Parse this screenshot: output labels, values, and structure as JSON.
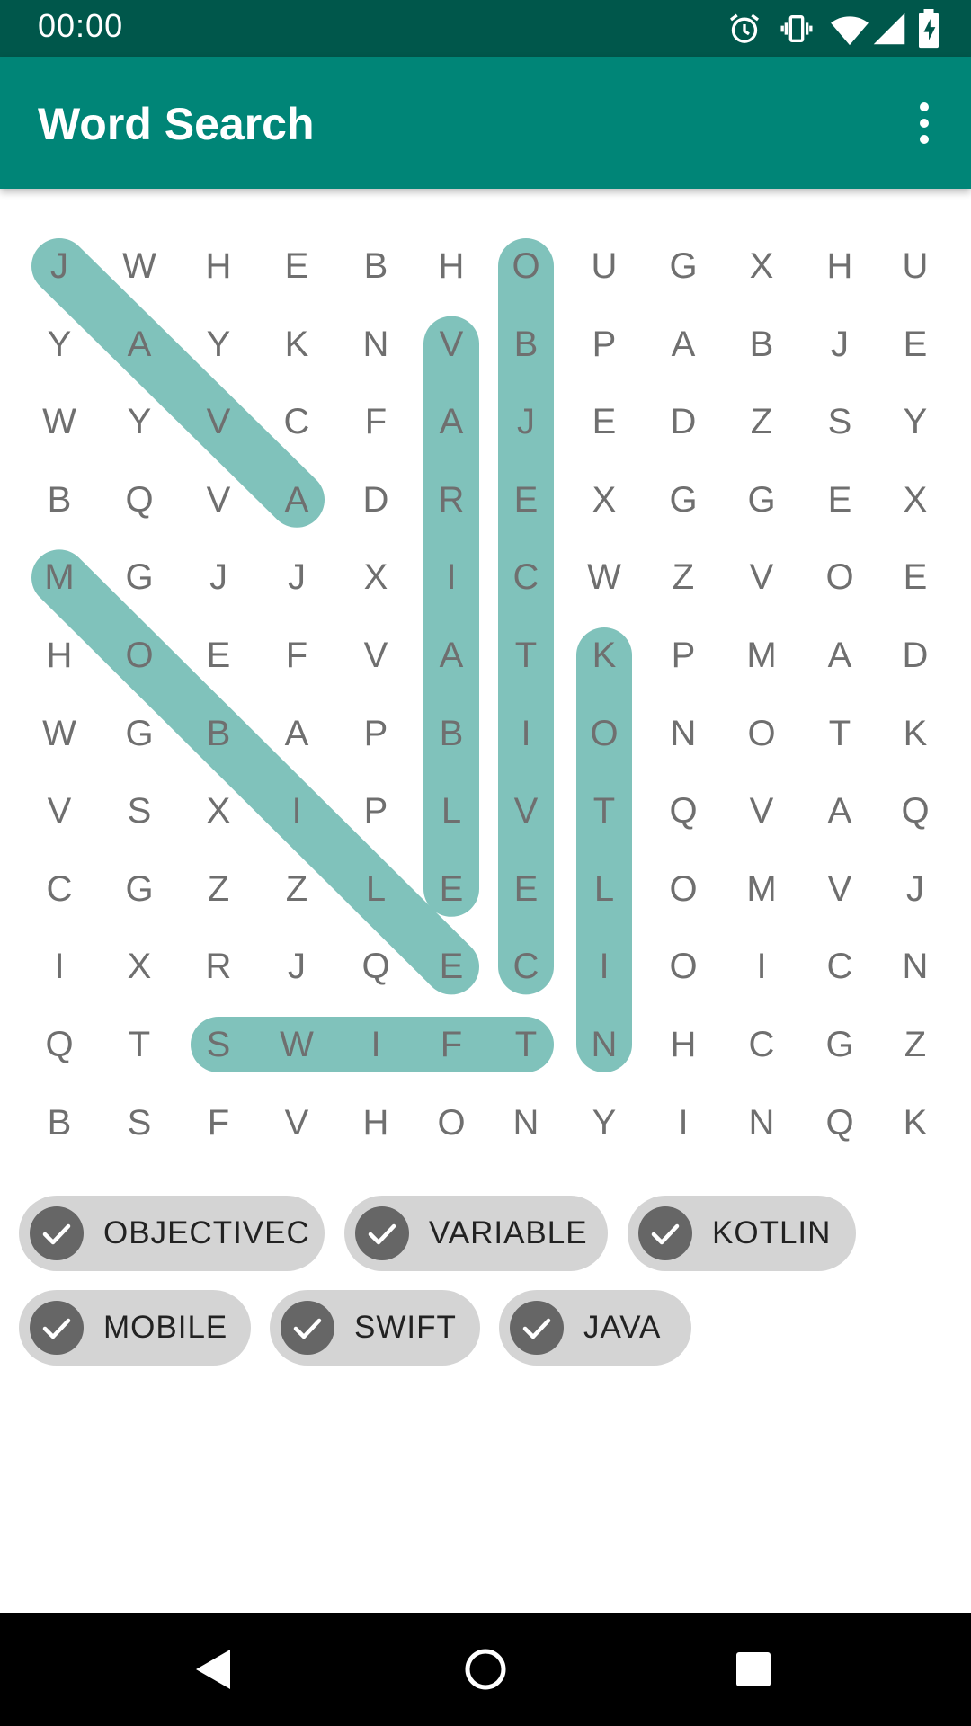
{
  "status_bar": {
    "time": "00:00",
    "icons": [
      "alarm-icon",
      "vibrate-icon",
      "wifi-icon",
      "signal-icon",
      "battery-charging-icon"
    ]
  },
  "app_bar": {
    "title": "Word Search",
    "menu_icon": "more-vert-icon"
  },
  "theme": {
    "primary": "#008577",
    "primary_dark": "#00574b",
    "highlight": "#80c2bb",
    "letter": "#6f6f6f",
    "chip_bg": "#d4d4d4",
    "chip_check": "#666666"
  },
  "grid": {
    "rows": [
      [
        "J",
        "W",
        "H",
        "E",
        "B",
        "H",
        "O",
        "U",
        "G",
        "X",
        "H",
        "U"
      ],
      [
        "Y",
        "A",
        "Y",
        "K",
        "N",
        "V",
        "B",
        "P",
        "A",
        "B",
        "J",
        "E"
      ],
      [
        "W",
        "Y",
        "V",
        "C",
        "F",
        "A",
        "J",
        "E",
        "D",
        "Z",
        "S",
        "Y"
      ],
      [
        "B",
        "Q",
        "V",
        "A",
        "D",
        "R",
        "E",
        "X",
        "G",
        "G",
        "E",
        "X"
      ],
      [
        "M",
        "G",
        "J",
        "J",
        "X",
        "I",
        "C",
        "W",
        "Z",
        "V",
        "O",
        "E"
      ],
      [
        "H",
        "O",
        "E",
        "F",
        "V",
        "A",
        "T",
        "K",
        "P",
        "M",
        "A",
        "D"
      ],
      [
        "W",
        "G",
        "B",
        "A",
        "P",
        "B",
        "I",
        "O",
        "N",
        "O",
        "T",
        "K"
      ],
      [
        "V",
        "S",
        "X",
        "I",
        "P",
        "L",
        "V",
        "T",
        "Q",
        "V",
        "A",
        "Q"
      ],
      [
        "C",
        "G",
        "Z",
        "Z",
        "L",
        "E",
        "E",
        "L",
        "O",
        "M",
        "V",
        "J"
      ],
      [
        "I",
        "X",
        "R",
        "J",
        "Q",
        "E",
        "C",
        "I",
        "O",
        "I",
        "C",
        "N"
      ],
      [
        "Q",
        "T",
        "S",
        "W",
        "I",
        "F",
        "T",
        "N",
        "H",
        "C",
        "G",
        "Z"
      ],
      [
        "B",
        "S",
        "F",
        "V",
        "H",
        "O",
        "N",
        "Y",
        "I",
        "N",
        "Q",
        "K"
      ]
    ]
  },
  "found_words": [
    {
      "word": "JAVA",
      "start": [
        0,
        0
      ],
      "end": [
        3,
        3
      ]
    },
    {
      "word": "VARIABLE",
      "start": [
        1,
        5
      ],
      "end": [
        8,
        5
      ]
    },
    {
      "word": "OBJECTIVEC",
      "start": [
        0,
        6
      ],
      "end": [
        9,
        6
      ]
    },
    {
      "word": "MOBILE",
      "start": [
        4,
        0
      ],
      "end": [
        9,
        5
      ]
    },
    {
      "word": "KOTLIN",
      "start": [
        5,
        7
      ],
      "end": [
        10,
        7
      ]
    },
    {
      "word": "SWIFT",
      "start": [
        10,
        2
      ],
      "end": [
        10,
        6
      ]
    }
  ],
  "word_chips": [
    {
      "label": "OBJECTIVEC",
      "checked": true
    },
    {
      "label": "VARIABLE",
      "checked": true
    },
    {
      "label": "KOTLIN",
      "checked": true
    },
    {
      "label": "MOBILE",
      "checked": true
    },
    {
      "label": "SWIFT",
      "checked": true
    },
    {
      "label": "JAVA",
      "checked": true
    }
  ],
  "nav_bar": {
    "buttons": [
      "back-icon",
      "home-icon",
      "recents-icon"
    ]
  }
}
